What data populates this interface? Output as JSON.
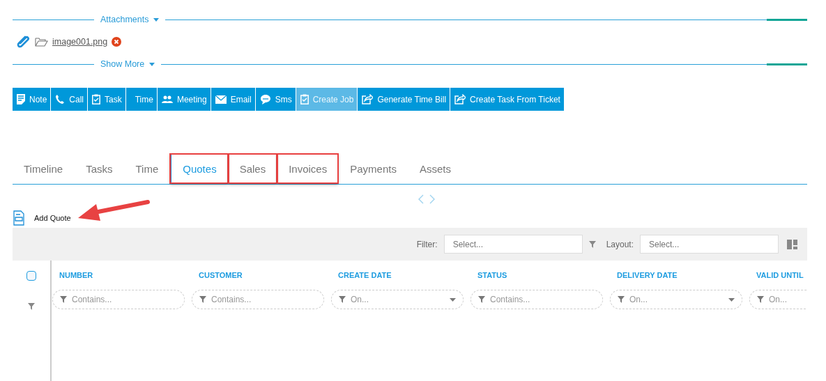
{
  "attachments_divider": {
    "label": "Attachments"
  },
  "attachments": [
    {
      "file_name": "image001.png"
    }
  ],
  "show_more_divider": {
    "label": "Show More"
  },
  "toolbar": [
    {
      "label": "Note",
      "kind": "note",
      "disabled": false
    },
    {
      "label": "Call",
      "kind": "phone",
      "disabled": false
    },
    {
      "label": "Task",
      "kind": "clipboard",
      "disabled": false
    },
    {
      "label": "Time",
      "kind": "plain",
      "disabled": false
    },
    {
      "label": "Meeting",
      "kind": "people",
      "disabled": false
    },
    {
      "label": "Email",
      "kind": "envelope",
      "disabled": false
    },
    {
      "label": "Sms",
      "kind": "chat",
      "disabled": false
    },
    {
      "label": "Create Job",
      "kind": "clipboard",
      "disabled": true
    },
    {
      "label": "Generate Time Bill",
      "kind": "share",
      "disabled": false
    },
    {
      "label": "Create Task From Ticket",
      "kind": "share",
      "disabled": false
    }
  ],
  "tabs": [
    {
      "label": "Timeline",
      "selected": false,
      "highlighted": false
    },
    {
      "label": "Tasks",
      "selected": false,
      "highlighted": false
    },
    {
      "label": "Time",
      "selected": false,
      "highlighted": false
    },
    {
      "label": "Quotes",
      "selected": true,
      "highlighted": true
    },
    {
      "label": "Sales",
      "selected": false,
      "highlighted": true
    },
    {
      "label": "Invoices",
      "selected": false,
      "highlighted": true
    },
    {
      "label": "Payments",
      "selected": false,
      "highlighted": false
    },
    {
      "label": "Assets",
      "selected": false,
      "highlighted": false
    }
  ],
  "add_button": {
    "label": "Add Quote"
  },
  "filter_bar": {
    "filter_label": "Filter:",
    "filter_placeholder": "Select...",
    "layout_label": "Layout:",
    "layout_placeholder": "Select..."
  },
  "grid": {
    "select_all_checked": false,
    "columns": [
      {
        "header": "NUMBER",
        "filter_placeholder": "Contains...",
        "dropdown": false
      },
      {
        "header": "CUSTOMER",
        "filter_placeholder": "Contains...",
        "dropdown": false
      },
      {
        "header": "CREATE DATE",
        "filter_placeholder": "On...",
        "dropdown": true
      },
      {
        "header": "STATUS",
        "filter_placeholder": "Contains...",
        "dropdown": false
      },
      {
        "header": "DELIVERY DATE",
        "filter_placeholder": "On...",
        "dropdown": true
      },
      {
        "header": "VALID UNTIL",
        "filter_placeholder": "On..."
      }
    ]
  }
}
